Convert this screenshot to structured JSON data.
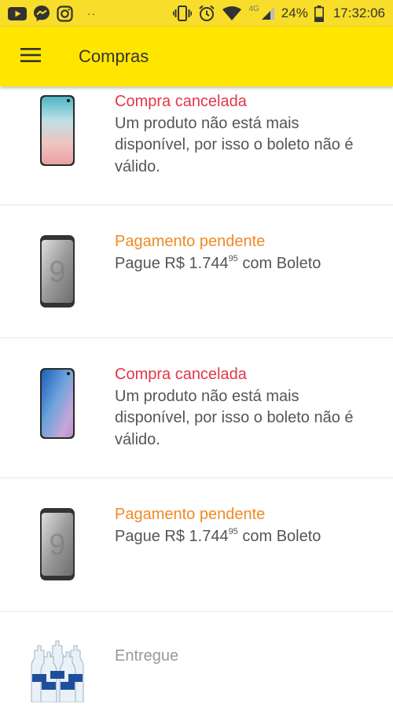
{
  "status_bar": {
    "icons": [
      "youtube-icon",
      "messenger-icon",
      "instagram-icon"
    ],
    "dots": "··",
    "network": "4G",
    "battery": "24%",
    "time": "17:32:06"
  },
  "app_bar": {
    "title": "Compras",
    "menu_icon": "menu-icon"
  },
  "colors": {
    "app_bar": "#ffe600",
    "canceled": "#e0374a",
    "pending": "#f08a24",
    "delivered": "#999999"
  },
  "purchases": [
    {
      "status": "Compra cancelada",
      "status_type": "canceled",
      "description": "Um produto não está mais disponível, por isso o boleto não é válido.",
      "product_image": "galaxy-s10-pink-icon"
    },
    {
      "status": "Pagamento pendente",
      "status_type": "pending",
      "description_prefix": "Pague R$ 1.744",
      "description_cents": "95",
      "description_suffix": " com Boleto",
      "product_image": "galaxy-s9-gray-icon"
    },
    {
      "status": "Compra cancelada",
      "status_type": "canceled",
      "description": "Um produto não está mais disponível, por isso o boleto não é válido.",
      "product_image": "galaxy-s10-blue-icon"
    },
    {
      "status": "Pagamento pendente",
      "status_type": "pending",
      "description_prefix": "Pague R$ 1.744",
      "description_cents": "95",
      "description_suffix": " com Boleto",
      "product_image": "galaxy-s9-gray-icon"
    },
    {
      "status": "Entregue",
      "status_type": "delivered",
      "product_image": "vodka-bottles-icon"
    }
  ]
}
